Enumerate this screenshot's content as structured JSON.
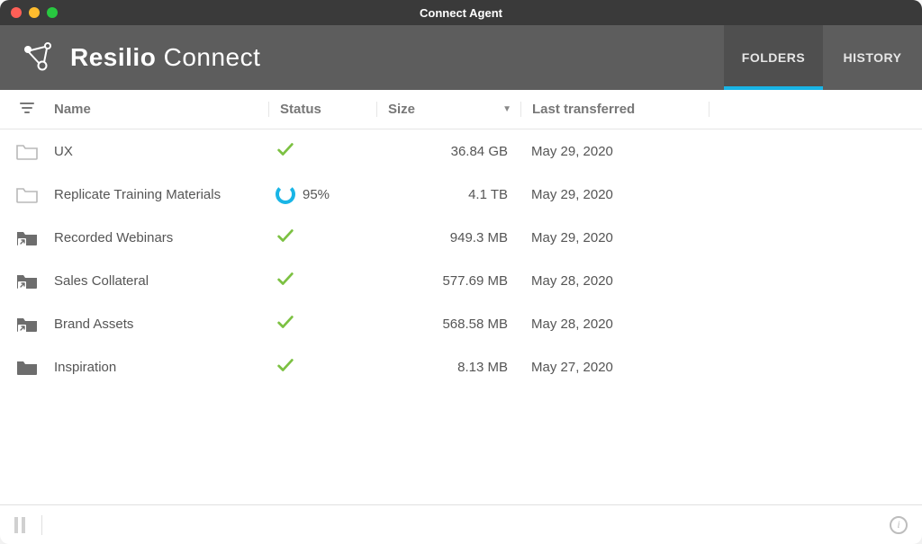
{
  "window": {
    "title": "Connect Agent"
  },
  "brand": {
    "bold": "Resilio",
    "light": "Connect"
  },
  "tabs": {
    "folders": "FOLDERS",
    "history": "HISTORY",
    "active": "folders"
  },
  "columns": {
    "name": "Name",
    "status": "Status",
    "size": "Size",
    "date": "Last transferred"
  },
  "rows": [
    {
      "icon": "folder-outline",
      "name": "UX",
      "status": "done",
      "progress": "",
      "size": "36.84 GB",
      "date": "May 29, 2020"
    },
    {
      "icon": "folder-outline",
      "name": "Replicate Training Materials",
      "status": "sync",
      "progress": "95%",
      "size": "4.1 TB",
      "date": "May 29, 2020"
    },
    {
      "icon": "folder-link",
      "name": "Recorded Webinars",
      "status": "done",
      "progress": "",
      "size": "949.3 MB",
      "date": "May 29, 2020"
    },
    {
      "icon": "folder-link",
      "name": "Sales Collateral",
      "status": "done",
      "progress": "",
      "size": "577.69 MB",
      "date": "May 28, 2020"
    },
    {
      "icon": "folder-link",
      "name": "Brand Assets",
      "status": "done",
      "progress": "",
      "size": "568.58 MB",
      "date": "May 28, 2020"
    },
    {
      "icon": "folder-solid",
      "name": "Inspiration",
      "status": "done",
      "progress": "",
      "size": "8.13 MB",
      "date": "May 27, 2020"
    }
  ]
}
